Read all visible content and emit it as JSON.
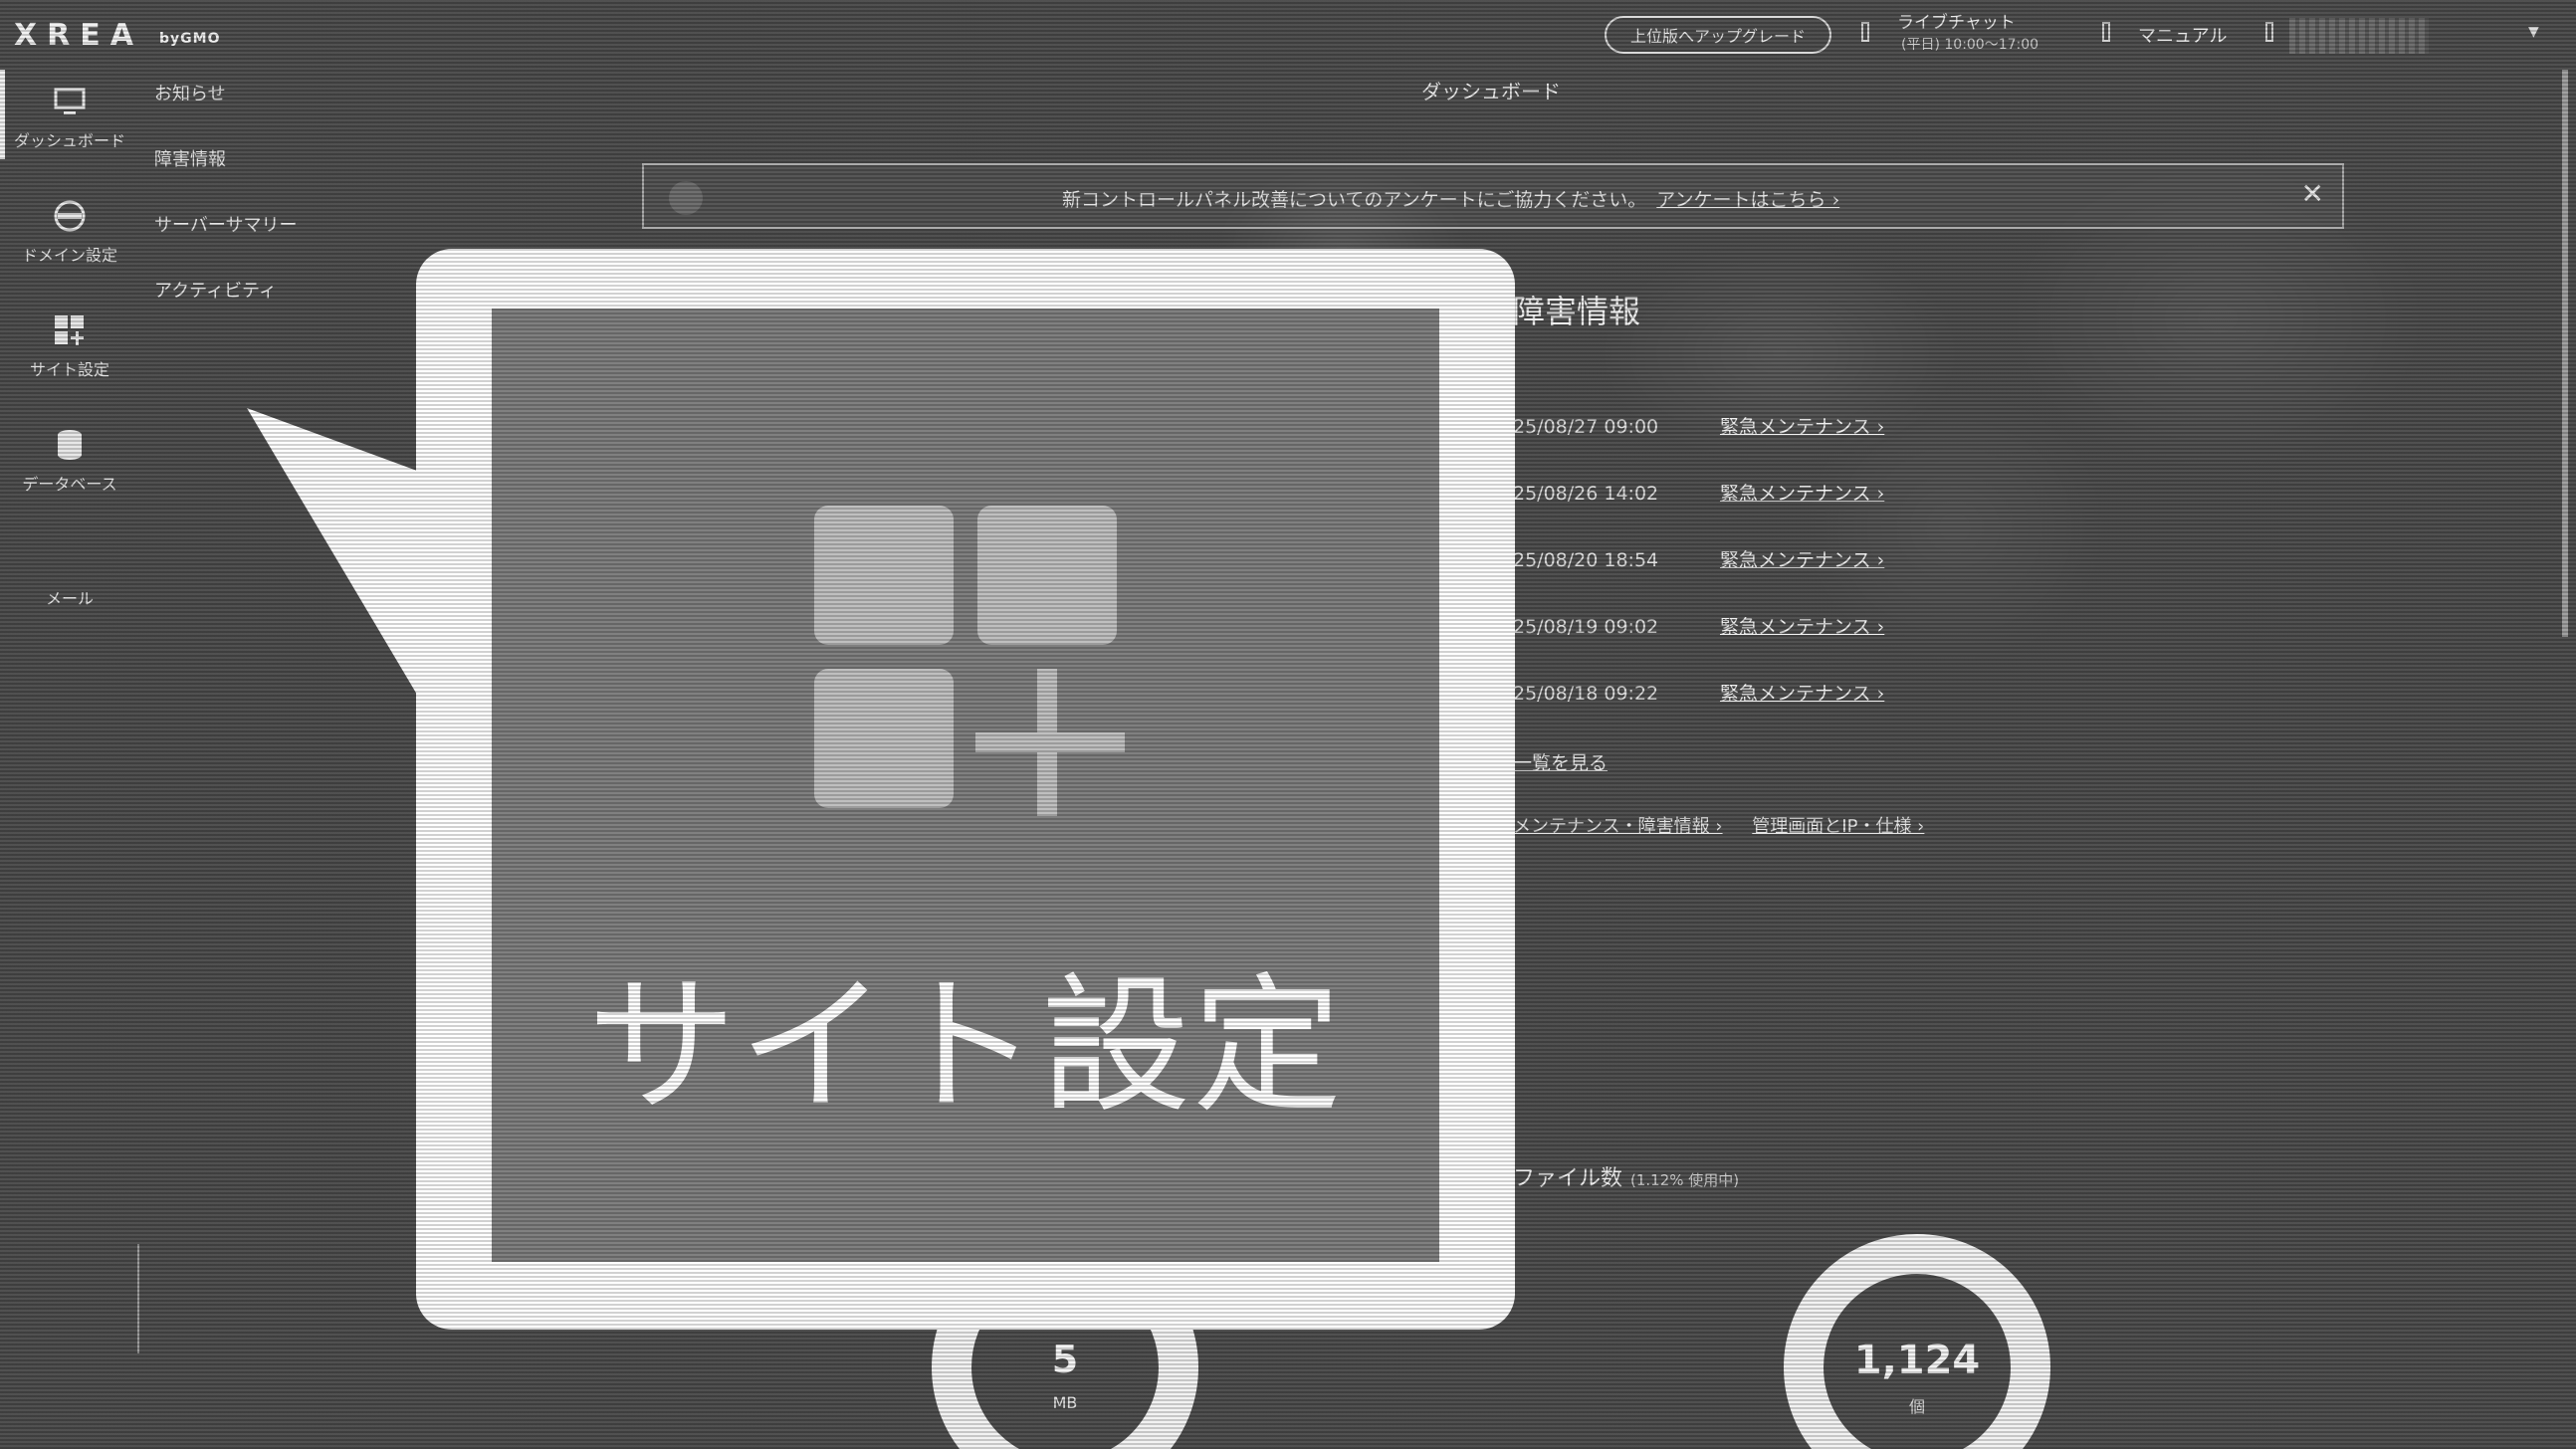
{
  "header": {
    "logo": "XREA",
    "logo_sub": "byGMO",
    "upgrade_label": "上位版へアップグレード",
    "chat_title": "ライブチャット",
    "chat_hours": "(平日) 10:00～17:00",
    "manual_label": "マニュアル"
  },
  "sidebar": {
    "items": [
      {
        "label": "ダッシュボード",
        "icon": "monitor-icon"
      },
      {
        "label": "ドメイン設定",
        "icon": "www-globe-icon"
      },
      {
        "label": "サイト設定",
        "icon": "site-settings-icon"
      },
      {
        "label": "データベース",
        "icon": "database-icon"
      },
      {
        "label": "メール",
        "icon": "mail-icon"
      }
    ],
    "sub_items": [
      "お知らせ",
      "障害情報",
      "サーバーサマリー",
      "アクティビティ"
    ]
  },
  "main": {
    "page_title": "ダッシュボード",
    "survey_text": "新コントロールパネル改善についてのアンケートにご協力ください。",
    "survey_link": "アンケートはこちら ›",
    "survey_close": "✕",
    "fault_title": "障害情報",
    "faults": [
      {
        "date": "25/08/27 09:00",
        "label": "緊急メンテナンス ›"
      },
      {
        "date": "25/08/26 14:02",
        "label": "緊急メンテナンス ›"
      },
      {
        "date": "25/08/20 18:54",
        "label": "緊急メンテナンス ›"
      },
      {
        "date": "25/08/19 09:02",
        "label": "緊急メンテナンス ›"
      },
      {
        "date": "25/08/18 09:22",
        "label": "緊急メンテナンス ›"
      }
    ],
    "more_label": "一覧を見る",
    "bottom_links": [
      "メンテナンス・障害情報 ›",
      "管理画面とIP・仕様 ›"
    ],
    "file_count_label": "ファイル数",
    "file_count_usage": "(1.12% 使用中)",
    "disk_value": "5",
    "disk_unit": "MB",
    "files_value": "1,124",
    "files_unit": "個"
  },
  "callout": {
    "label": "サイト設定",
    "icon": "site-settings-icon"
  }
}
